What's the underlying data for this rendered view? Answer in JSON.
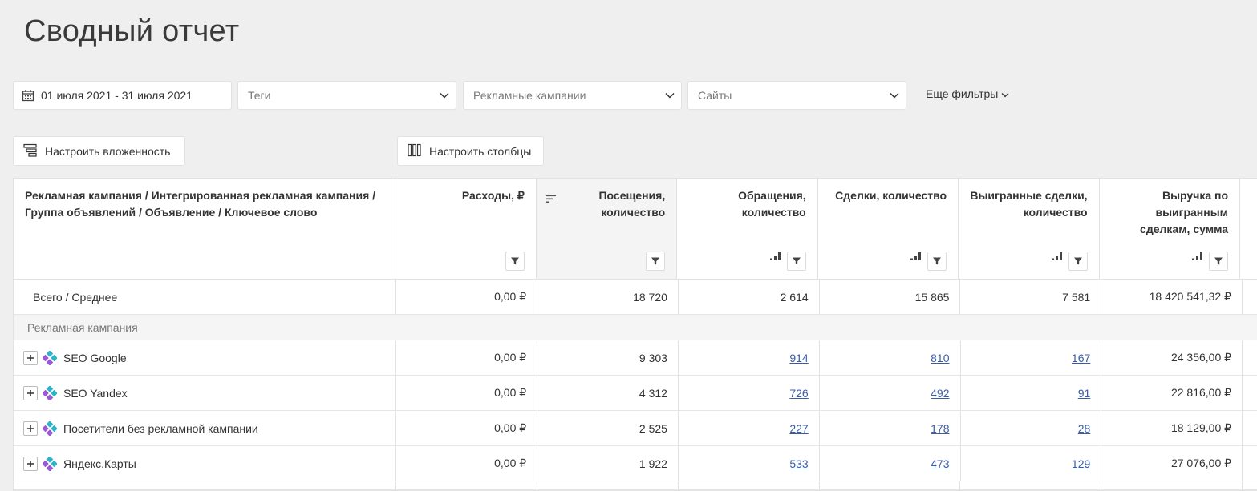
{
  "page": {
    "title": "Сводный отчет"
  },
  "filters": {
    "date": "01 июля 2021 - 31 июля 2021",
    "tags_placeholder": "Теги",
    "campaigns_placeholder": "Рекламные кампании",
    "sites_placeholder": "Сайты",
    "more_label": "Еще фильтры"
  },
  "toolbar": {
    "nesting_label": "Настроить вложенность",
    "columns_label": "Настроить столбцы"
  },
  "table": {
    "headers": [
      "Рекламная кампания / Интегрированная рекламная кампания / Группа объявлений / Объявление / Ключевое слово",
      "Расходы, ₽",
      "Посещения, количество",
      "Обращения, количество",
      "Сделки, количество",
      "Выигранные сделки, количество",
      "Выручка по выигранным сделкам, сумма"
    ],
    "total": {
      "label": "Всего / Среднее",
      "values": [
        "0,00 ₽",
        "18 720",
        "2 614",
        "15 865",
        "7 581",
        "18 420 541,32 ₽"
      ]
    },
    "group_label": "Рекламная кампания",
    "rows": [
      {
        "name": "SEO Google",
        "values": [
          "0,00 ₽",
          "9 303",
          "914",
          "810",
          "167",
          "24 356,00 ₽"
        ]
      },
      {
        "name": "SEO Yandex",
        "values": [
          "0,00 ₽",
          "4 312",
          "726",
          "492",
          "91",
          "22 816,00 ₽"
        ]
      },
      {
        "name": "Посетители без рекламной кампании",
        "values": [
          "0,00 ₽",
          "2 525",
          "227",
          "178",
          "28",
          "18 129,00 ₽"
        ]
      },
      {
        "name": "Яндекс.Карты",
        "values": [
          "0,00 ₽",
          "1 922",
          "533",
          "473",
          "129",
          "27 076,00 ₽"
        ]
      }
    ]
  },
  "colors": {
    "link": "#3a5ca8",
    "logo_teal": "#2bb5c9",
    "logo_purple": "#9b59d6"
  }
}
